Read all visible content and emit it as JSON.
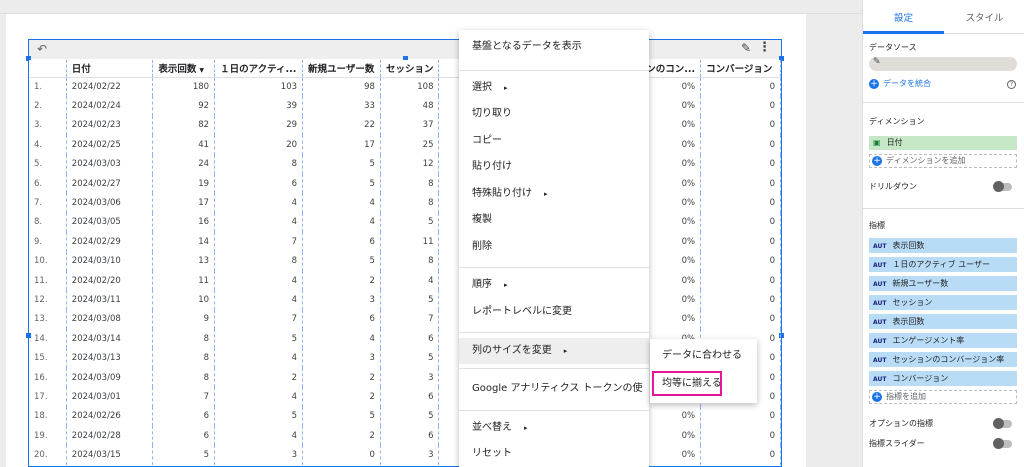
{
  "table": {
    "headers": [
      "",
      "日付",
      "表示回数",
      "１日のアクティ...",
      "新規ユーザー数",
      "セッション",
      "",
      "ンのコン...",
      "コンバージョン"
    ],
    "rows": [
      [
        "1.",
        "2024/02/22",
        "180",
        "103",
        "98",
        "108",
        "0%",
        "0"
      ],
      [
        "2.",
        "2024/02/24",
        "92",
        "39",
        "33",
        "48",
        "0%",
        "0"
      ],
      [
        "3.",
        "2024/02/23",
        "82",
        "29",
        "22",
        "37",
        "0%",
        "0"
      ],
      [
        "4.",
        "2024/02/25",
        "41",
        "20",
        "17",
        "25",
        "0%",
        "0"
      ],
      [
        "5.",
        "2024/03/03",
        "24",
        "8",
        "5",
        "12",
        "0%",
        "0"
      ],
      [
        "6.",
        "2024/02/27",
        "19",
        "6",
        "5",
        "8",
        "0%",
        "0"
      ],
      [
        "7.",
        "2024/03/06",
        "17",
        "4",
        "4",
        "8",
        "0%",
        "0"
      ],
      [
        "8.",
        "2024/03/05",
        "16",
        "4",
        "4",
        "5",
        "0%",
        "0"
      ],
      [
        "9.",
        "2024/02/29",
        "14",
        "7",
        "6",
        "11",
        "0%",
        "0"
      ],
      [
        "10.",
        "2024/03/10",
        "13",
        "8",
        "5",
        "8",
        "0%",
        "0"
      ],
      [
        "11.",
        "2024/02/20",
        "11",
        "4",
        "2",
        "4",
        "0%",
        "0"
      ],
      [
        "12.",
        "2024/03/11",
        "10",
        "4",
        "3",
        "5",
        "0%",
        "0"
      ],
      [
        "13.",
        "2024/03/08",
        "9",
        "7",
        "6",
        "7",
        "0%",
        "0"
      ],
      [
        "14.",
        "2024/03/14",
        "8",
        "5",
        "4",
        "6",
        "0%",
        "0"
      ],
      [
        "15.",
        "2024/03/13",
        "8",
        "4",
        "3",
        "5",
        "0%",
        "0"
      ],
      [
        "16.",
        "2024/03/09",
        "8",
        "2",
        "2",
        "3",
        "0%",
        "0"
      ],
      [
        "17.",
        "2024/03/01",
        "7",
        "4",
        "2",
        "6",
        "0%",
        "0"
      ],
      [
        "18.",
        "2024/02/26",
        "6",
        "5",
        "5",
        "5",
        "0%",
        "0"
      ],
      [
        "19.",
        "2024/02/28",
        "6",
        "4",
        "2",
        "6",
        "0%",
        "0"
      ],
      [
        "20.",
        "2024/03/15",
        "5",
        "3",
        "0",
        "3",
        "0%",
        "0"
      ]
    ]
  },
  "context_menu": {
    "items": [
      "基盤となるデータを表示",
      "選択",
      "切り取り",
      "コピー",
      "貼り付け",
      "特殊貼り付け",
      "複製",
      "削除",
      "順序",
      "レポートレベルに変更",
      "列のサイズを変更",
      "Google アナリティクス トークンの使",
      "並べ替え",
      "リセット"
    ],
    "arrow": "▸"
  },
  "submenu": {
    "items": [
      "データに合わせる",
      "均等に揃える"
    ]
  },
  "panel": {
    "tabs": [
      "設定",
      "スタイル"
    ],
    "data_source_title": "データソース",
    "blend_label": "データを統合",
    "dimension_title": "ディメンション",
    "dimension_chip": "日付",
    "add_dimension": "ディメンションを追加",
    "drilldown": "ドリルダウン",
    "metrics_title": "指標",
    "aut": "AUT",
    "metrics": [
      "表示回数",
      "１日のアクティブ ユーザー",
      "新規ユーザー数",
      "セッション",
      "表示回数",
      "エンゲージメント率",
      "セッションのコンバージョン率",
      "コンバージョン"
    ],
    "add_metric": "指標を追加",
    "optional_metrics": "オプションの指標",
    "metric_slider": "指標スライダー"
  },
  "colors": {
    "selection": "#1a73e8",
    "highlight": "#e3169a",
    "dimension_chip": "#c7e8c7",
    "metric_chip": "#b9dcf6"
  }
}
